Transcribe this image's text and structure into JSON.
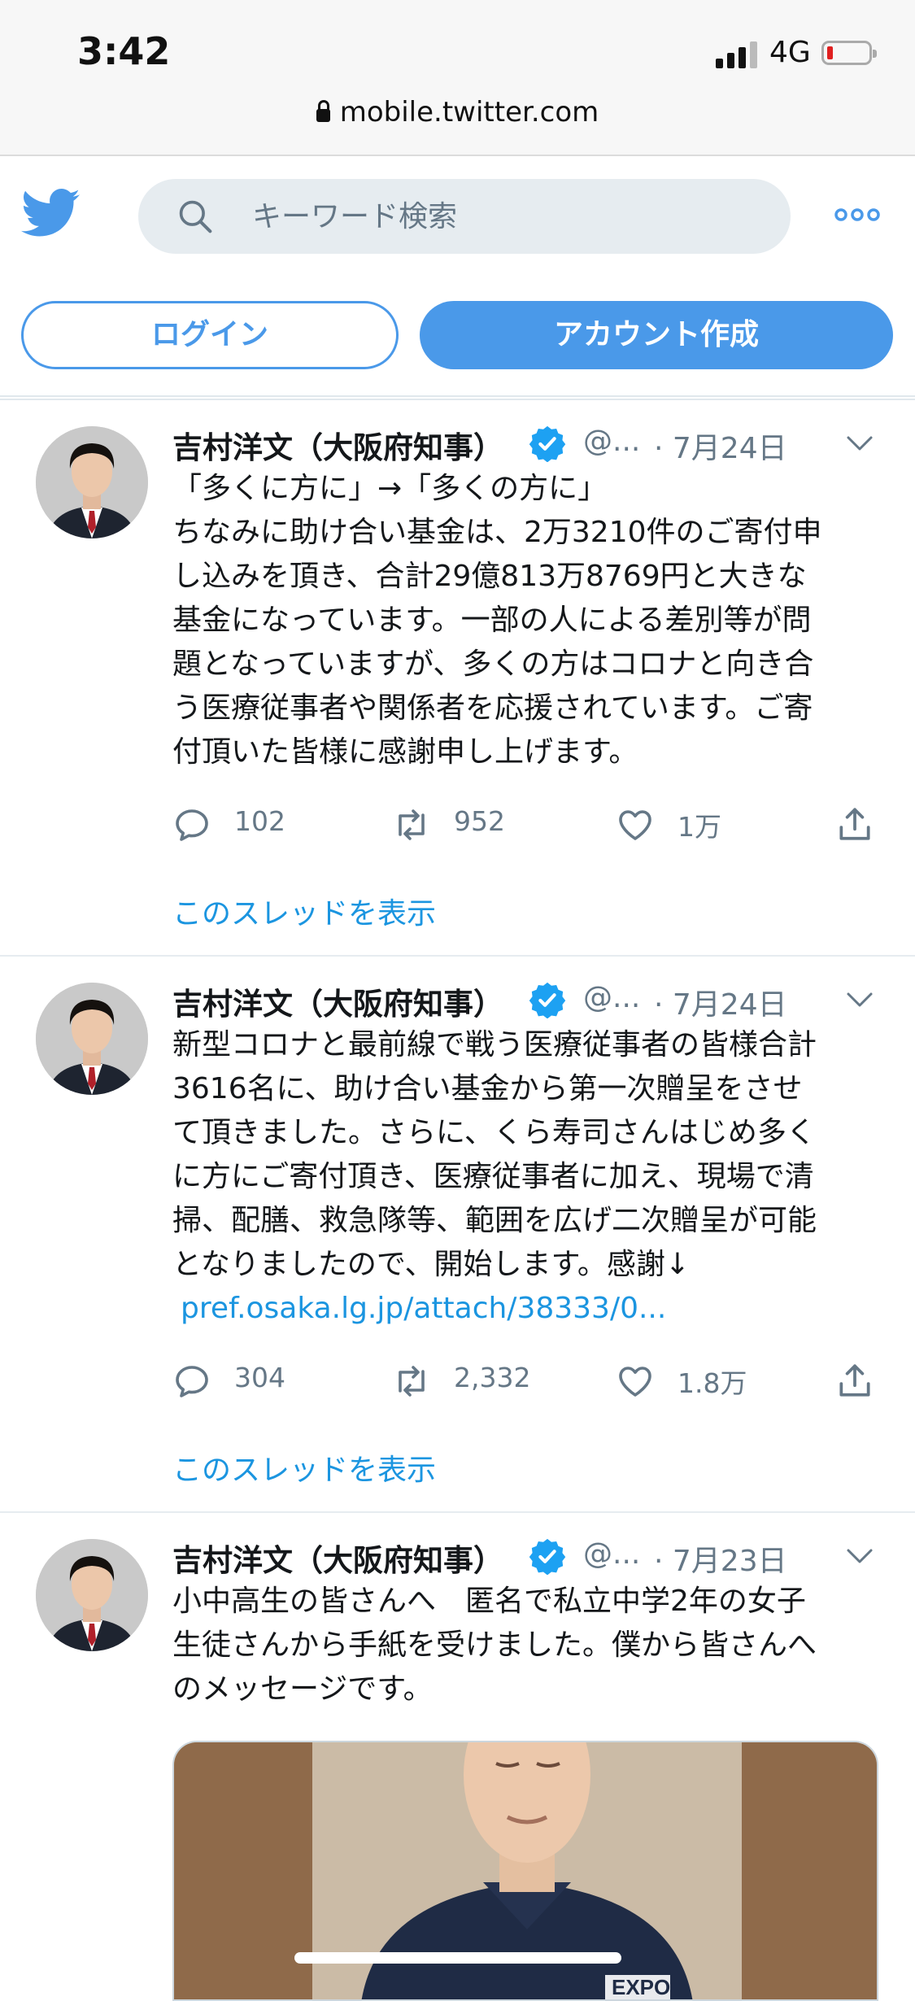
{
  "status": {
    "time": "3:42",
    "network": "4G",
    "url": "mobile.twitter.com"
  },
  "header": {
    "search_placeholder": "キーワード検索",
    "login_label": "ログイン",
    "signup_label": "アカウント作成",
    "brand_color": "#4a99e9"
  },
  "tweets": [
    {
      "name": "吉村洋文（大阪府知事）",
      "handle": "@...",
      "date": "· 7月24日",
      "lines": [
        "「多くに方に」→「多くの方に」",
        "ちなみに助け合い基金は、2万3210件のご寄付申",
        "し込みを頂き、合計29億813万8769円と大きな",
        "基金になっています。一部の人による差別等が問",
        "題となっていますが、多くの方はコロナと向き合",
        "う医療従事者や関係者を応援されています。ご寄",
        "付頂いた皆様に感謝申し上げます。"
      ],
      "replies": "102",
      "retweets": "952",
      "likes": "1万",
      "thread": "このスレッドを表示"
    },
    {
      "name": "吉村洋文（大阪府知事）",
      "handle": "@...",
      "date": "· 7月24日",
      "lines": [
        "新型コロナと最前線で戦う医療従事者の皆様合計",
        "3616名に、助け合い基金から第一次贈呈をさせ",
        "て頂きました。さらに、くら寿司さんはじめ多く",
        "に方にご寄付頂き、医療従事者に加え、現場で清",
        "掃、配膳、救急隊等、範囲を広げ二次贈呈が可能",
        "となりましたので、開始します。感謝↓"
      ],
      "link": "pref.osaka.lg.jp/attach/38333/0...",
      "replies": "304",
      "retweets": "2,332",
      "likes": "1.8万",
      "thread": "このスレッドを表示"
    },
    {
      "name": "吉村洋文（大阪府知事）",
      "handle": "@...",
      "date": "· 7月23日",
      "lines": [
        "小中高生の皆さんへ　匿名で私立中学2年の女子",
        "生徒さんから手紙を受けました。僕から皆さんへ",
        "のメッセージです。"
      ],
      "media_text": "EXPO"
    }
  ]
}
